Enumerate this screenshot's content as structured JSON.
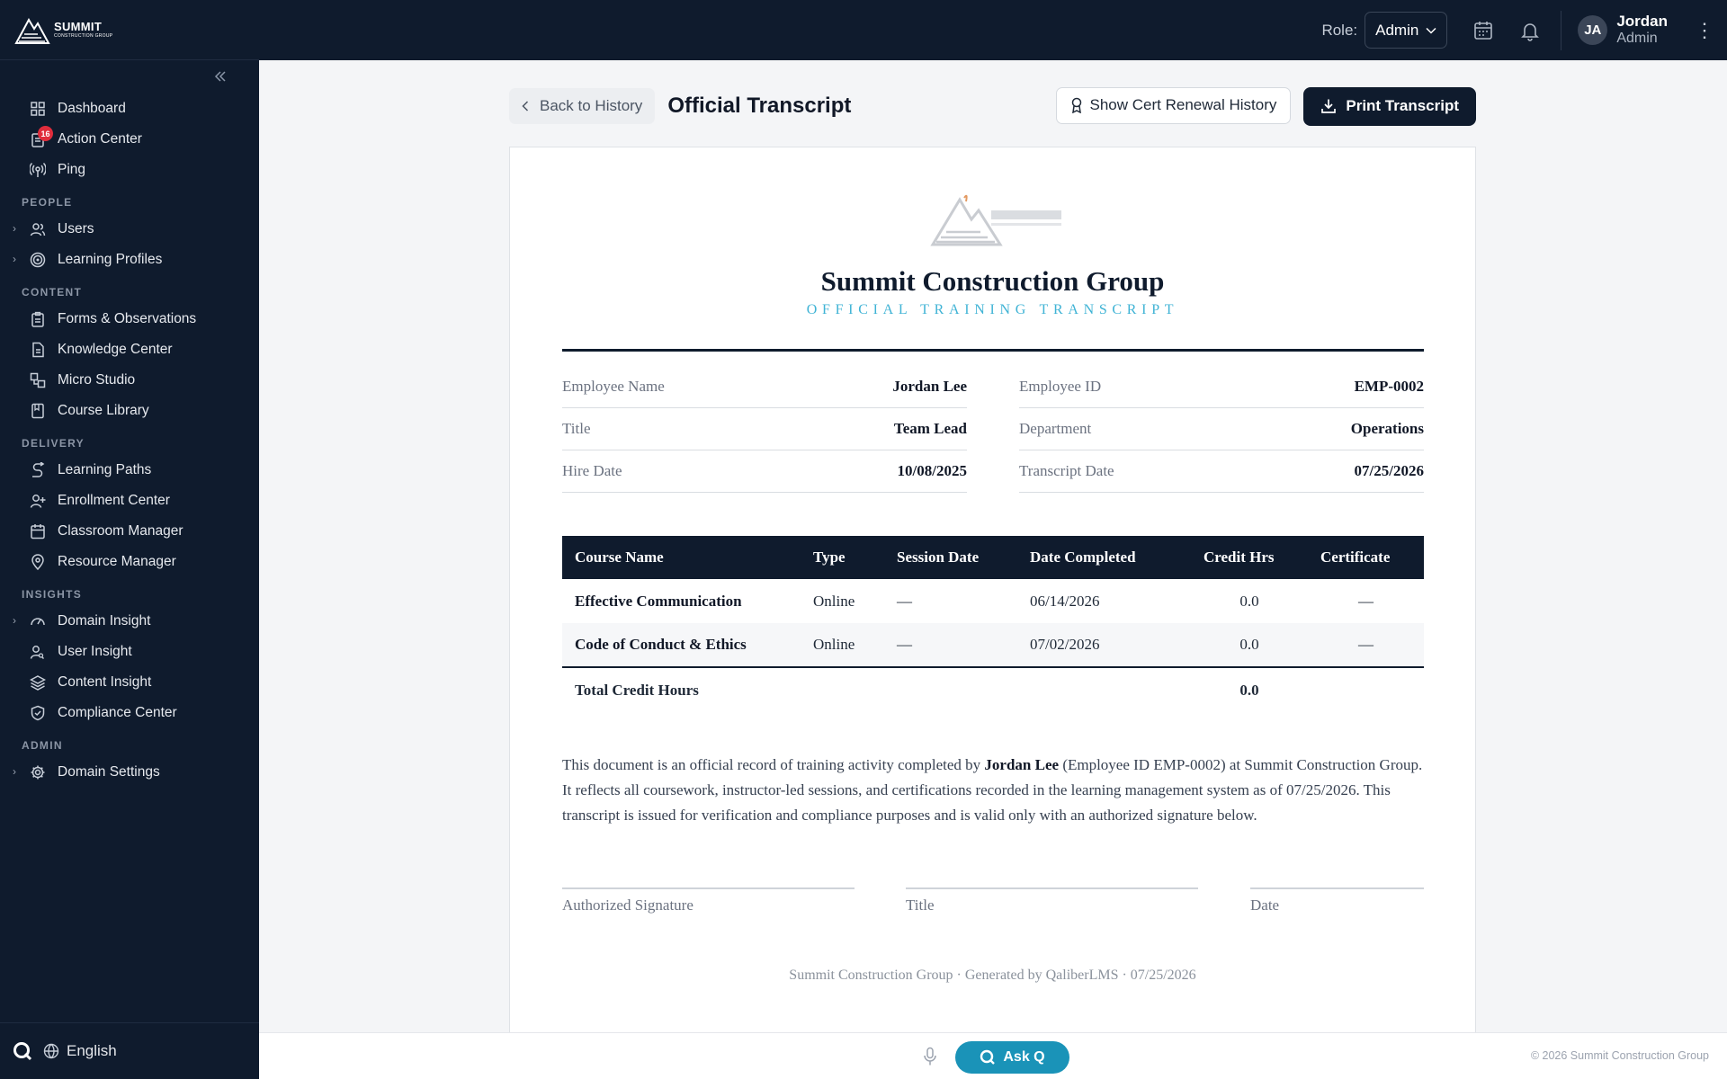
{
  "brand": {
    "name": "SUMMIT",
    "sub": "CONSTRUCTION GROUP"
  },
  "sidebar": {
    "collapse_icon": "chevrons-left-icon",
    "items_top": [
      {
        "label": "Dashboard",
        "icon": "grid-icon"
      },
      {
        "label": "Action Center",
        "icon": "clipboard-icon",
        "badge": "16"
      },
      {
        "label": "Ping",
        "icon": "broadcast-icon"
      }
    ],
    "sections": [
      {
        "title": "PEOPLE",
        "items": [
          {
            "label": "Users",
            "icon": "users-icon",
            "expandable": true
          },
          {
            "label": "Learning Profiles",
            "icon": "target-icon",
            "expandable": true
          }
        ]
      },
      {
        "title": "CONTENT",
        "items": [
          {
            "label": "Forms & Observations",
            "icon": "clipboard-list-icon"
          },
          {
            "label": "Knowledge Center",
            "icon": "file-text-icon"
          },
          {
            "label": "Micro Studio",
            "icon": "shapes-icon"
          },
          {
            "label": "Course Library",
            "icon": "book-icon"
          }
        ]
      },
      {
        "title": "DELIVERY",
        "items": [
          {
            "label": "Learning Paths",
            "icon": "route-icon"
          },
          {
            "label": "Enrollment Center",
            "icon": "user-plus-icon"
          },
          {
            "label": "Classroom Manager",
            "icon": "calendar-icon"
          },
          {
            "label": "Resource Manager",
            "icon": "map-pin-icon"
          }
        ]
      },
      {
        "title": "INSIGHTS",
        "items": [
          {
            "label": "Domain Insight",
            "icon": "gauge-icon",
            "expandable": true
          },
          {
            "label": "User Insight",
            "icon": "user-search-icon"
          },
          {
            "label": "Content Insight",
            "icon": "layers-icon"
          },
          {
            "label": "Compliance Center",
            "icon": "shield-check-icon"
          }
        ]
      },
      {
        "title": "ADMIN",
        "items": [
          {
            "label": "Domain Settings",
            "icon": "gear-icon",
            "expandable": true
          }
        ]
      }
    ],
    "footer": {
      "language": "English"
    }
  },
  "topbar": {
    "role_label": "Role:",
    "role_value": "Admin",
    "user_initials": "JA",
    "user_name": "Jordan",
    "user_role": "Admin"
  },
  "page": {
    "back_label": "Back to History",
    "title": "Official Transcript",
    "cert_history_label": "Show Cert Renewal History",
    "print_label": "Print Transcript"
  },
  "transcript": {
    "company": "Summit Construction Group",
    "subtitle": "OFFICIAL TRAINING TRANSCRIPT",
    "info_left": [
      {
        "label": "Employee Name",
        "value": "Jordan Lee"
      },
      {
        "label": "Title",
        "value": "Team Lead"
      },
      {
        "label": "Hire Date",
        "value": "10/08/2025"
      }
    ],
    "info_right": [
      {
        "label": "Employee ID",
        "value": "EMP-0002"
      },
      {
        "label": "Department",
        "value": "Operations"
      },
      {
        "label": "Transcript Date",
        "value": "07/25/2026"
      }
    ],
    "columns": [
      "Course Name",
      "Type",
      "Session Date",
      "Date Completed",
      "Credit Hrs",
      "Certificate"
    ],
    "rows": [
      {
        "course": "Effective Communication",
        "type": "Online",
        "session": "—",
        "completed": "06/14/2026",
        "credit": "0.0",
        "certificate": "—"
      },
      {
        "course": "Code of Conduct & Ethics",
        "type": "Online",
        "session": "—",
        "completed": "07/02/2026",
        "credit": "0.0",
        "certificate": "—"
      }
    ],
    "total_label": "Total Credit Hours",
    "total_value": "0.0",
    "para_1": "This document is an official record of training activity completed by ",
    "para_name": "Jordan Lee",
    "para_2": " (Employee ID EMP-0002) at Summit Construction Group. It reflects all coursework, instructor-led sessions, and certifications recorded in the learning management system as of 07/25/2026. This transcript is issued for verification and compliance purposes and is valid only with an authorized signature below.",
    "sig_authorized": "Authorized Signature",
    "sig_title": "Title",
    "sig_date": "Date",
    "footer": "Summit Construction Group · Generated by QaliberLMS · 07/25/2026"
  },
  "bottombar": {
    "ask_label": "Ask Q",
    "copyright": "© 2026 Summit Construction Group"
  },
  "colors": {
    "navy": "#0f1b2d",
    "accent": "#3fb3d5",
    "ask_q": "#1a93b8",
    "badge": "#e02d3c"
  }
}
